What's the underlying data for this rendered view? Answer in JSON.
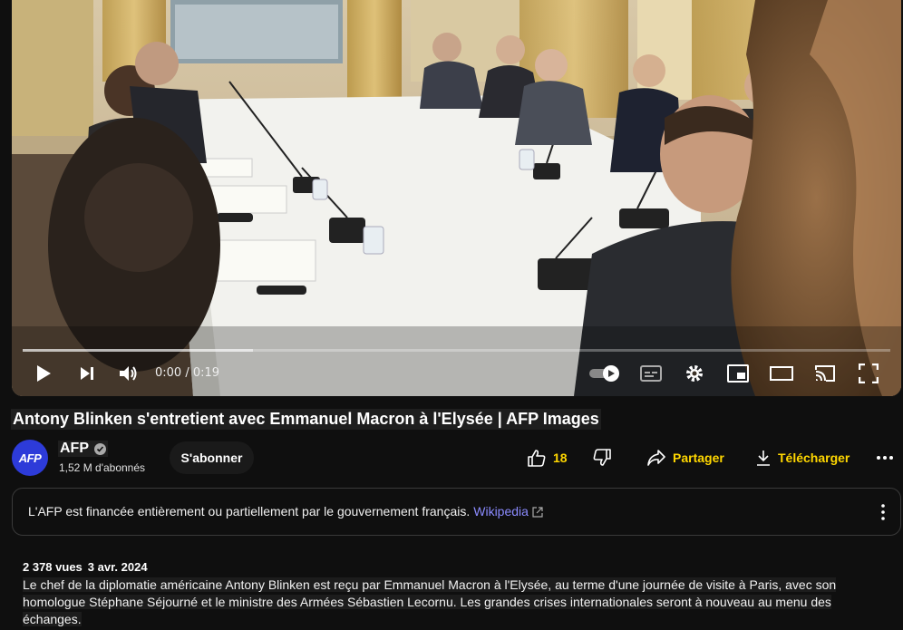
{
  "player": {
    "time": "0:00 / 0:19",
    "progress_fraction": 0.0,
    "buffered_fraction": 0.265
  },
  "video": {
    "title": "Antony Blinken s'entretient avec Emmanuel Macron à l'Elysée | AFP Images"
  },
  "channel": {
    "avatar_text": "AFP",
    "name": "AFP",
    "subscribers": "1,52 M d'abonnés",
    "subscribe_label": "S'abonner"
  },
  "actions": {
    "like_count": "18",
    "share_label": "Partager",
    "download_label": "Télécharger"
  },
  "info_panel": {
    "text": "L'AFP est financée entièrement ou partiellement par le gouvernement français.",
    "link": "Wikipedia"
  },
  "description": {
    "views": "2 378 vues",
    "date": "3 avr. 2024",
    "line1": "Le chef de la diplomatie américaine Antony Blinken est reçu par Emmanuel Macron à l'Elysée, au terme d'une journée de visite à Paris, avec son",
    "line2": "homologue Stéphane Séjourné et le ministre des Armées Sébastien Lecornu. Les grandes crises internationales seront à nouveau au menu des échanges."
  },
  "colors": {
    "accent_text": "#ffd700",
    "link": "#8b8bff",
    "avatar_bg": "#2d3bd9",
    "background": "#0f0f0f"
  },
  "icons": [
    "play-icon",
    "next-icon",
    "volume-icon",
    "autoplay-toggle-icon",
    "subtitles-icon",
    "settings-icon",
    "miniplayer-icon",
    "theater-icon",
    "cast-icon",
    "fullscreen-icon",
    "verified-icon",
    "like-icon",
    "dislike-icon",
    "share-icon",
    "download-icon",
    "more-icon",
    "external-link-icon"
  ]
}
